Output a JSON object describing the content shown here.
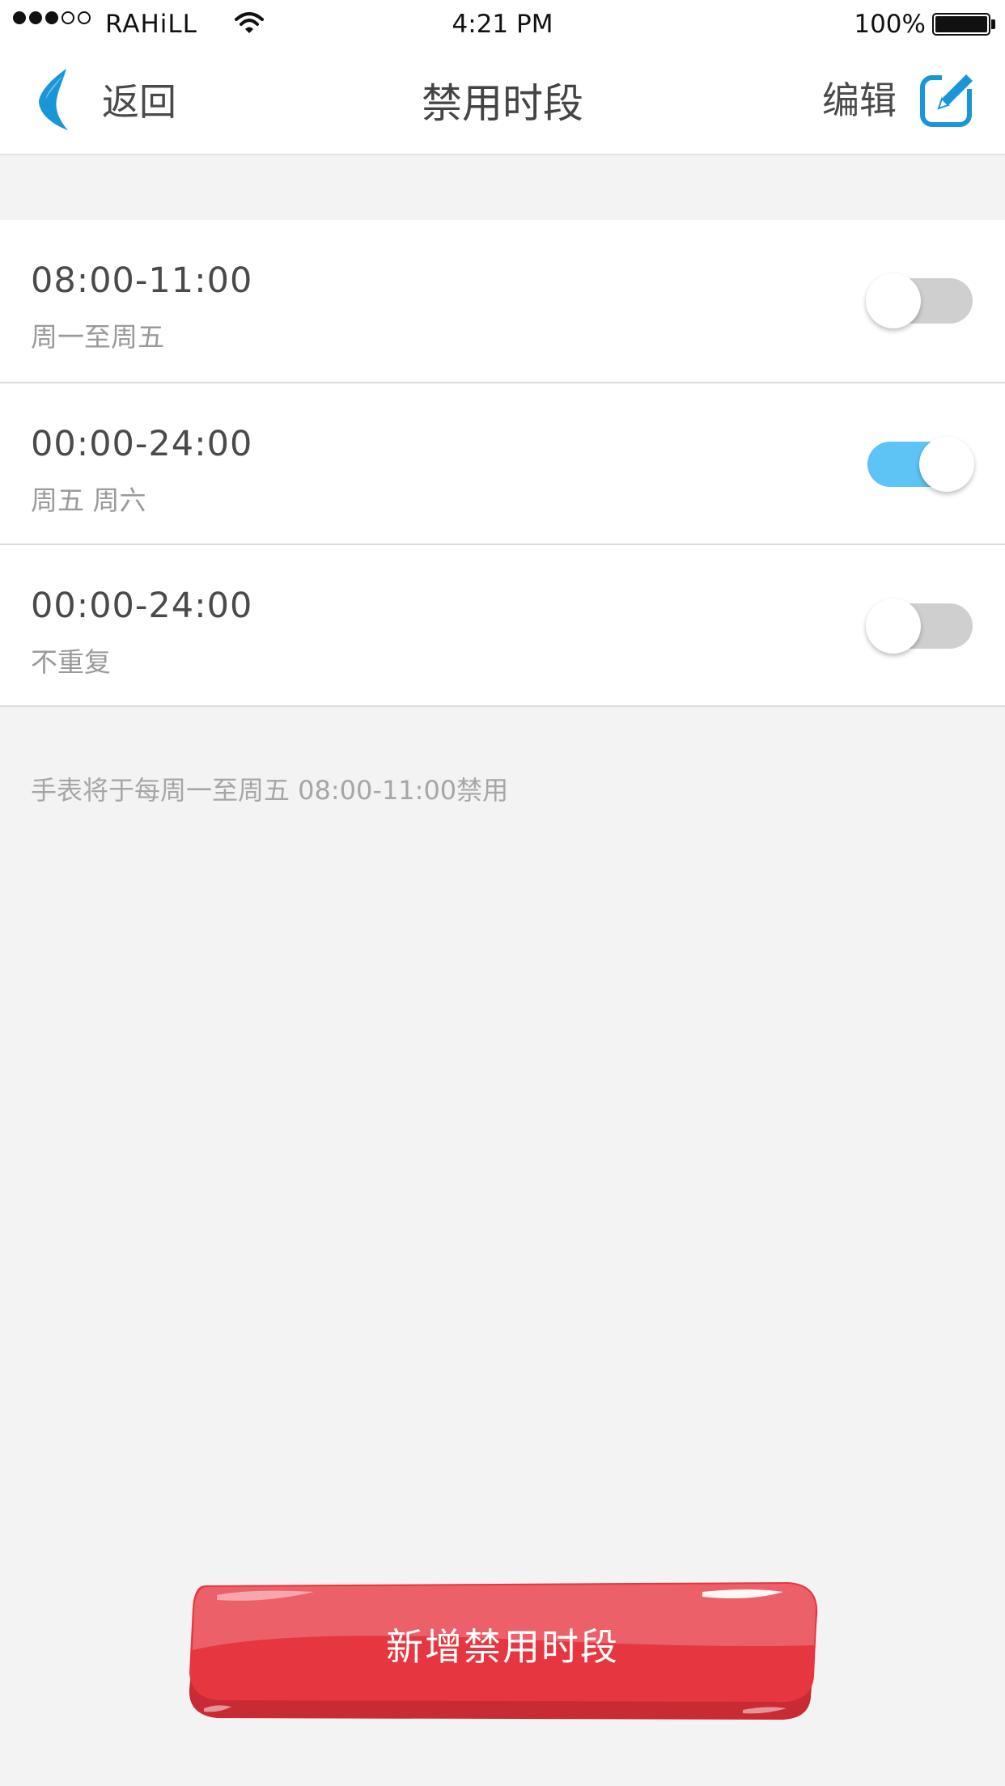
{
  "status_bar": {
    "carrier": "RAHiLL",
    "time": "4:21 PM",
    "battery": "100%",
    "icons": [
      "signal-dots",
      "wifi-icon",
      "battery-icon"
    ]
  },
  "nav": {
    "back_label": "返回",
    "title": "禁用时段",
    "edit_label": "编辑",
    "icons": [
      "back-arrow-icon",
      "edit-icon"
    ]
  },
  "schedules": [
    {
      "time": "08:00-11:00",
      "days": "周一至周五",
      "enabled": false
    },
    {
      "time": "00:00-24:00",
      "days": "周五 周六",
      "enabled": true
    },
    {
      "time": "00:00-24:00",
      "days": "不重复",
      "enabled": false
    }
  ],
  "summary": "手表将于每周一至周五 08:00-11:00禁用",
  "add_button_label": "新增禁用时段",
  "colors": {
    "accent": "#5ec3f5",
    "brand_blue": "#1a95d8",
    "button_red": "#e6363f",
    "background": "#f3f3f3"
  }
}
